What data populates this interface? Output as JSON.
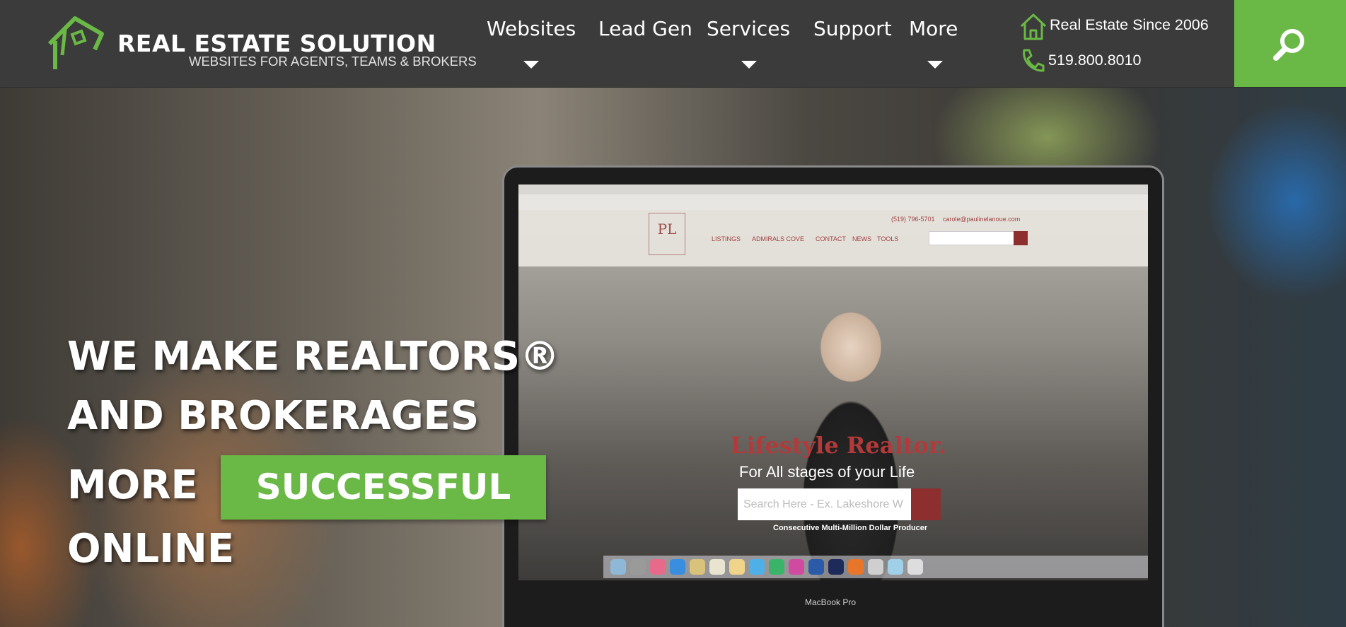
{
  "logo": {
    "title": "REAL ESTATE SOLUTION",
    "subtitle": "WEBSITES FOR AGENTS, TEAMS & BROKERS",
    "icon": "house-logo-icon"
  },
  "nav": {
    "items": [
      {
        "label": "Websites",
        "has_dropdown": true
      },
      {
        "label": "Lead Gen",
        "has_dropdown": false
      },
      {
        "label": "Services",
        "has_dropdown": true
      },
      {
        "label": "Support",
        "has_dropdown": false
      },
      {
        "label": "More",
        "has_dropdown": true
      }
    ]
  },
  "contact": {
    "since_text": "Real Estate Since 2006",
    "since_icon": "house-icon",
    "phone": "519.800.8010",
    "phone_icon": "phone-icon"
  },
  "search": {
    "icon": "search-icon"
  },
  "hero": {
    "line1": "WE MAKE REALTORS®",
    "line2": "AND BROKERAGES",
    "line3": "MORE",
    "highlight": "SUCCESSFUL",
    "line4": "ONLINE"
  },
  "screen_content": {
    "headline": "Lifestyle Realtor.",
    "tagline": "For All stages of your Life",
    "search_placeholder": "Search Here - Ex. Lakeshore W",
    "producer_text": "Consecutive Multi-Million Dollar Producer",
    "logo_text": "PL",
    "nav": [
      "LISTINGS",
      "ADMIRALS COVE",
      "CONTACT",
      "NEWS",
      "TOOLS"
    ],
    "phone": "(519) 796-5701",
    "email": "carole@paulinelanoue.com",
    "device_label": "MacBook Pro"
  },
  "colors": {
    "accent": "#6ab845",
    "header_bg": "#3b3b3b",
    "site_accent": "#8d2f2f"
  }
}
